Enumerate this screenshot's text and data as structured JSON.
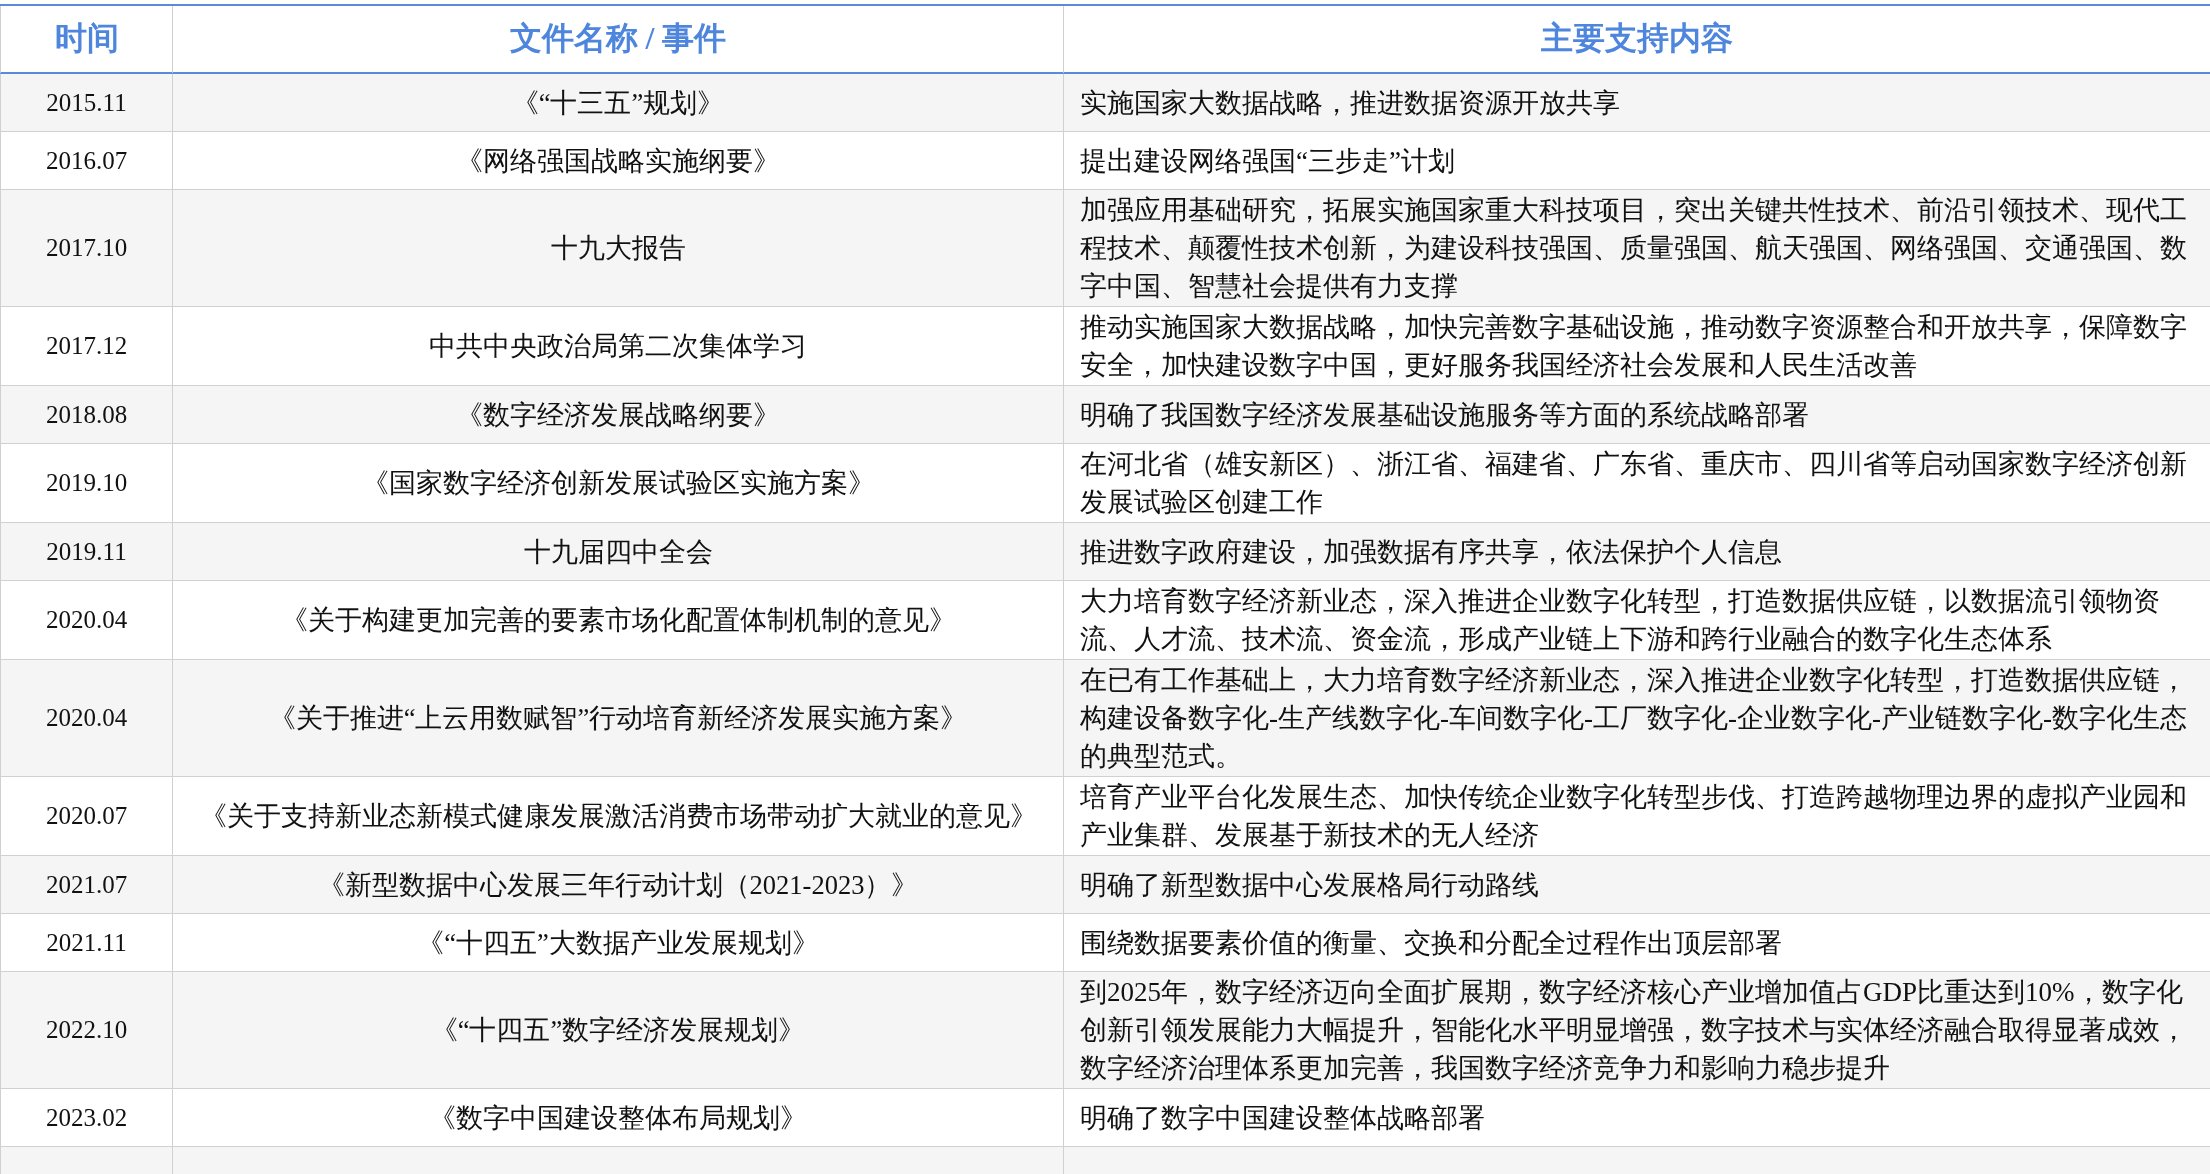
{
  "table": {
    "columns": [
      "时间",
      "文件名称 / 事件",
      "主要支持内容"
    ],
    "rows": [
      {
        "time": "2015.11",
        "name": "《“十三五”规划》",
        "content": "实施国家大数据战略，推进数据资源开放共享"
      },
      {
        "time": "2016.07",
        "name": "《网络强国战略实施纲要》",
        "content": "提出建设网络强国“三步走”计划"
      },
      {
        "time": "2017.10",
        "name": "十九大报告",
        "content": "加强应用基础研究，拓展实施国家重大科技项目，突出关键共性技术、前沿引领技术、现代工程技术、颠覆性技术创新，为建设科技强国、质量强国、航天强国、网络强国、交通强国、数字中国、智慧社会提供有力支撑"
      },
      {
        "time": "2017.12",
        "name": "中共中央政治局第二次集体学习",
        "content": "推动实施国家大数据战略，加快完善数字基础设施，推动数字资源整合和开放共享，保障数字安全，加快建设数字中国，更好服务我国经济社会发展和人民生活改善"
      },
      {
        "time": "2018.08",
        "name": "《数字经济发展战略纲要》",
        "content": "明确了我国数字经济发展基础设施服务等方面的系统战略部署"
      },
      {
        "time": "2019.10",
        "name": "《国家数字经济创新发展试验区实施方案》",
        "content": "在河北省（雄安新区）、浙江省、福建省、广东省、重庆市、四川省等启动国家数字经济创新发展试验区创建工作"
      },
      {
        "time": "2019.11",
        "name": "十九届四中全会",
        "content": "推进数字政府建设，加强数据有序共享，依法保护个人信息"
      },
      {
        "time": "2020.04",
        "name": "《关于构建更加完善的要素市场化配置体制机制的意见》",
        "content": "大力培育数字经济新业态，深入推进企业数字化转型，打造数据供应链，以数据流引领物资流、人才流、技术流、资金流，形成产业链上下游和跨行业融合的数字化生态体系"
      },
      {
        "time": "2020.04",
        "name": "《关于推进“上云用数赋智”行动培育新经济发展实施方案》",
        "content": "在已有工作基础上，大力培育数字经济新业态，深入推进企业数字化转型，打造数据供应链，构建设备数字化-生产线数字化-车间数字化-工厂数字化-企业数字化-产业链数字化-数字化生态的典型范式。"
      },
      {
        "time": "2020.07",
        "name": "《关于支持新业态新模式健康发展激活消费市场带动扩大就业的意见》",
        "content": "培育产业平台化发展生态、加快传统企业数字化转型步伐、打造跨越物理边界的虚拟产业园和产业集群、发展基于新技术的无人经济"
      },
      {
        "time": "2021.07",
        "name": "《新型数据中心发展三年行动计划（2021-2023）》",
        "content": "明确了新型数据中心发展格局行动路线"
      },
      {
        "time": "2021.11",
        "name": "《“十四五”大数据产业发展规划》",
        "content": "围绕数据要素价值的衡量、交换和分配全过程作出顶层部署"
      },
      {
        "time": "2022.10",
        "name": "《“十四五”数字经济发展规划》",
        "content": "到2025年，数字经济迈向全面扩展期，数字经济核心产业增加值占GDP比重达到10%，数字化创新引领发展能力大幅提升，智能化水平明显增强，数字技术与实体经济融合取得显著成效，数字经济治理体系更加完善，我国数字经济竞争力和影响力稳步提升"
      },
      {
        "time": "2023.02",
        "name": "《数字中国建设整体布局规划》",
        "content": "明确了数字中国建设整体战略部署"
      }
    ]
  }
}
